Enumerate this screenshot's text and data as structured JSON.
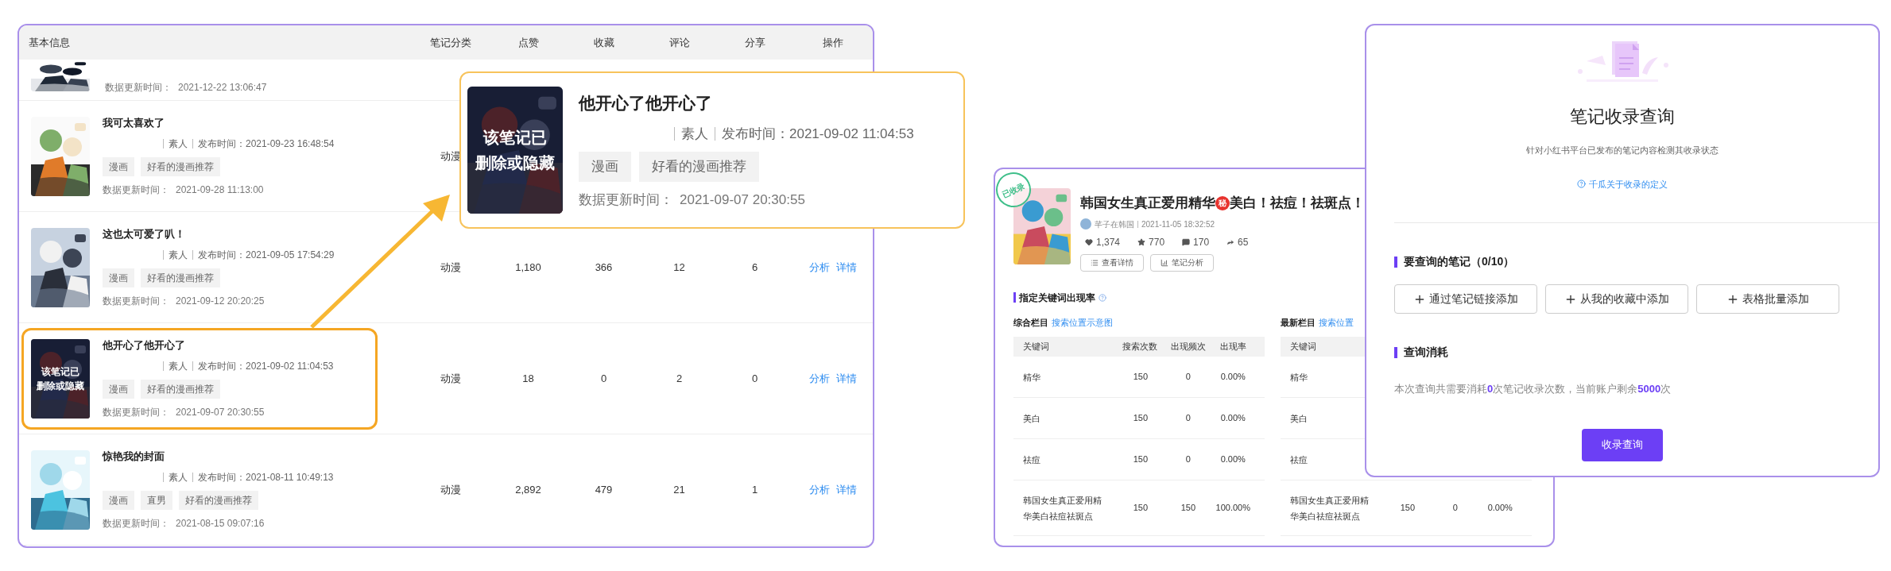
{
  "notes_table": {
    "columns": [
      "基本信息",
      "笔记分类",
      "点赞",
      "收藏",
      "评论",
      "分享",
      "操作"
    ],
    "rows": [
      {
        "kind": "partial",
        "update_label": "数据更新时间：",
        "update_time": "2021-12-22 13:06:47"
      },
      {
        "kind": "full",
        "highlighted": false,
        "title": "我可太喜欢了",
        "author_type": "素人",
        "publish_time": "发布时间：2021-09-23 16:48:54",
        "tags": [
          "漫画",
          "好看的漫画推荐"
        ],
        "update_label": "数据更新时间：",
        "update_time": "2021-09-28 11:13:00",
        "category": "动漫",
        "stats": [],
        "actions": []
      },
      {
        "kind": "full",
        "highlighted": false,
        "title": "这也太可爱了叭！",
        "author_type": "素人",
        "publish_time": "发布时间：2021-09-05 17:54:29",
        "tags": [
          "漫画",
          "好看的漫画推荐"
        ],
        "update_label": "数据更新时间：",
        "update_time": "2021-09-12 20:20:25",
        "category": "动漫",
        "stats": [
          "1,180",
          "366",
          "12",
          "6"
        ],
        "actions": [
          "分析",
          "详情"
        ]
      },
      {
        "kind": "full",
        "highlighted": true,
        "title": "他开心了他开心了",
        "author_type": "素人",
        "publish_time": "发布时间：2021-09-02 11:04:53",
        "tags": [
          "漫画",
          "好看的漫画推荐"
        ],
        "update_label": "数据更新时间：",
        "update_time": "2021-09-07 20:30:55",
        "image_overlay": [
          "该笔记已",
          "删除或隐藏"
        ],
        "category": "动漫",
        "stats": [
          "18",
          "0",
          "2",
          "0"
        ],
        "actions": [
          "分析",
          "详情"
        ]
      },
      {
        "kind": "full",
        "highlighted": false,
        "title": "惊艳我的封面",
        "author_type": "素人",
        "publish_time": "发布时间：2021-08-11 10:49:13",
        "tags": [
          "漫画",
          "直男",
          "好看的漫画推荐"
        ],
        "update_label": "数据更新时间：",
        "update_time": "2021-08-15 09:07:16",
        "category": "动漫",
        "stats": [
          "2,892",
          "479",
          "21",
          "1"
        ],
        "actions": [
          "分析",
          "详情"
        ]
      }
    ]
  },
  "zoom_card": {
    "title": "他开心了他开心了",
    "author_type": "素人",
    "publish_time": "发布时间：2021-09-02 11:04:53",
    "tags": [
      "漫画",
      "好看的漫画推荐"
    ],
    "update_label": "数据更新时间：",
    "update_time": "2021-09-07 20:30:55",
    "image_overlay": [
      "该笔记已",
      "删除或隐藏"
    ]
  },
  "note_analysis": {
    "stamp": "已收录",
    "title": "韩国女生真正爱用精华",
    "title_badge": "秘",
    "title_rest": "美白！祛痘！祛斑点！",
    "author": "芊子在韩国",
    "date": "2021-11-05 18:32:52",
    "stats": [
      {
        "kind": "likes",
        "value": "1,374"
      },
      {
        "kind": "collects",
        "value": "770"
      },
      {
        "kind": "comments",
        "value": "170"
      },
      {
        "kind": "shares",
        "value": "65"
      }
    ],
    "buttons": [
      {
        "kind": "detail",
        "label": "查看详情"
      },
      {
        "kind": "analysis",
        "label": "笔记分析"
      }
    ],
    "section_title": "指定关键词出现率",
    "tables": [
      {
        "title": "综合栏目",
        "link": "搜索位置示意图",
        "columns": [
          "关键词",
          "搜索次数",
          "出现频次",
          "出现率"
        ],
        "rows": [
          [
            "精华",
            "150",
            "0",
            "0.00%"
          ],
          [
            "美白",
            "150",
            "0",
            "0.00%"
          ],
          [
            "祛痘",
            "150",
            "0",
            "0.00%"
          ],
          [
            "韩国女生真正爱用精华美白祛痘祛斑点",
            "150",
            "150",
            "100.00%"
          ]
        ]
      },
      {
        "title": "最新栏目",
        "link": "搜索位置",
        "columns": [
          "关键词"
        ],
        "rows": [
          [
            "精华"
          ],
          [
            "美白"
          ],
          [
            "祛痘"
          ],
          [
            "韩国女生真正爱用精华美白祛痘祛斑点",
            "150",
            "0",
            "0.00%"
          ]
        ]
      }
    ]
  },
  "collect_query": {
    "title": "笔记收录查询",
    "subtitle": "针对小红书平台已发布的笔记内容检测其收录状态",
    "help_link": "千瓜关于收录的定义",
    "notes_section": "要查询的笔记（0/10）",
    "add_buttons": [
      "通过笔记链接添加",
      "从我的收藏中添加",
      "表格批量添加"
    ],
    "cost_section": "查询消耗",
    "cost_text": "本次查询共需要消耗**0**次笔记收录次数，当前账户剩余**5000**次",
    "submit": "收录查询"
  }
}
